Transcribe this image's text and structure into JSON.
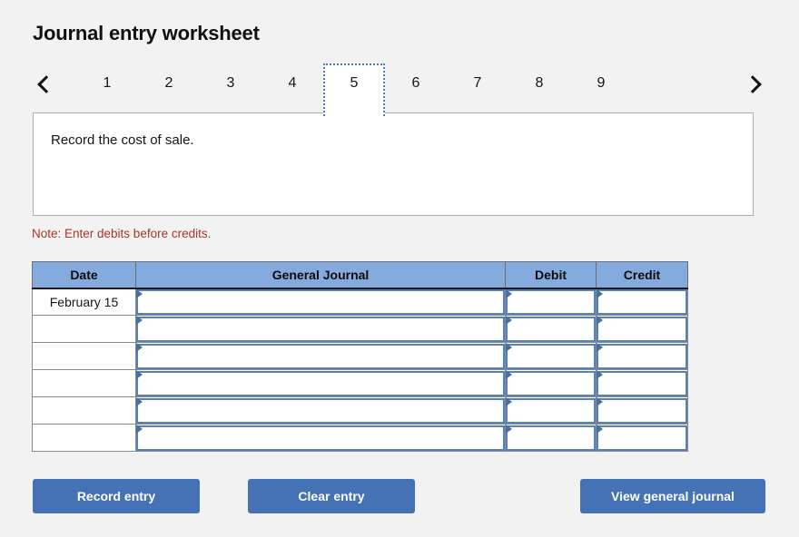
{
  "header": {
    "title": "Journal entry worksheet"
  },
  "tabs": {
    "prev_icon": "chevron-left-icon",
    "next_icon": "chevron-right-icon",
    "items": [
      {
        "label": "1",
        "active": false
      },
      {
        "label": "2",
        "active": false
      },
      {
        "label": "3",
        "active": false
      },
      {
        "label": "4",
        "active": false
      },
      {
        "label": "5",
        "active": true
      },
      {
        "label": "6",
        "active": false
      },
      {
        "label": "7",
        "active": false
      },
      {
        "label": "8",
        "active": false
      },
      {
        "label": "9",
        "active": false
      }
    ]
  },
  "instruction": {
    "text": "Record the cost of sale."
  },
  "note": {
    "text": "Note: Enter debits before credits."
  },
  "table": {
    "columns": [
      "Date",
      "General Journal",
      "Debit",
      "Credit"
    ],
    "rows": [
      {
        "date": "February 15",
        "general_journal": "",
        "debit": "",
        "credit": ""
      },
      {
        "date": "",
        "general_journal": "",
        "debit": "",
        "credit": ""
      },
      {
        "date": "",
        "general_journal": "",
        "debit": "",
        "credit": ""
      },
      {
        "date": "",
        "general_journal": "",
        "debit": "",
        "credit": ""
      },
      {
        "date": "",
        "general_journal": "",
        "debit": "",
        "credit": ""
      },
      {
        "date": "",
        "general_journal": "",
        "debit": "",
        "credit": ""
      }
    ]
  },
  "actions": {
    "record": "Record entry",
    "clear": "Clear entry",
    "view": "View general journal"
  },
  "colors": {
    "page_background": "#f2f2f2",
    "header_blue": "#85abde",
    "button_blue": "#4472b4",
    "note_red": "#a8352a",
    "input_border_blue": "#5681bd",
    "marker_blue": "#44719f"
  }
}
